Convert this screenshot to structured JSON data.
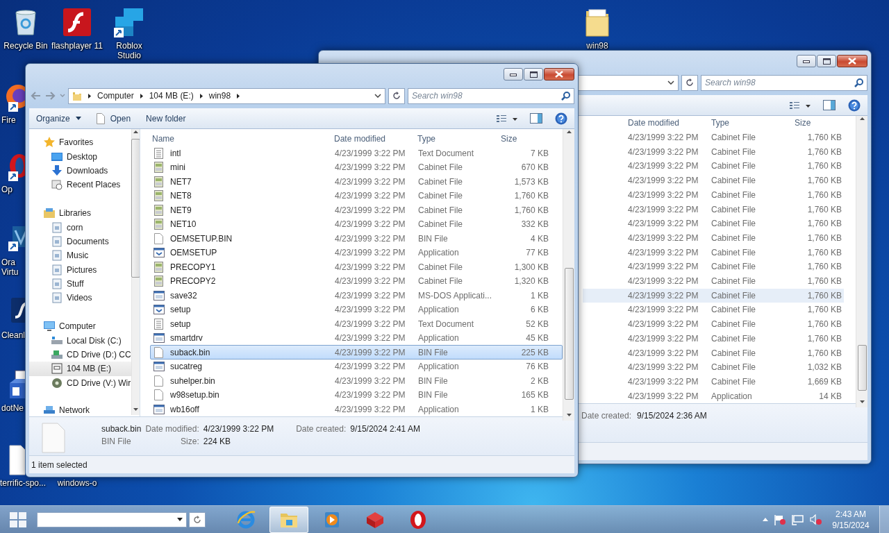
{
  "desktop_icons": [
    {
      "label": "Recycle Bin",
      "kind": "recycle"
    },
    {
      "label": "flashplayer 11",
      "kind": "flash"
    },
    {
      "label": "Roblox Studio",
      "kind": "roblox"
    },
    {
      "label": "win98",
      "kind": "folder"
    },
    {
      "label": "Fire",
      "kind": "firefox"
    },
    {
      "label": "Op",
      "kind": "opera"
    },
    {
      "label": "Ora Virtu",
      "kind": "vbox"
    },
    {
      "label": "Cleanl",
      "kind": "flashdark"
    },
    {
      "label": "dotNe",
      "kind": "setup"
    },
    {
      "label": "terrific-spo...",
      "kind": "blank"
    },
    {
      "label": "windows-o",
      "kind": "none"
    }
  ],
  "back_window": {
    "search_placeholder": "Search win98",
    "columns": [
      "Date modified",
      "Type",
      "Size"
    ],
    "rows": [
      {
        "date": "4/23/1999 3:22 PM",
        "type": "Cabinet File",
        "size": "1,760 KB",
        "selected": false
      },
      {
        "date": "4/23/1999 3:22 PM",
        "type": "Cabinet File",
        "size": "1,760 KB",
        "selected": false
      },
      {
        "date": "4/23/1999 3:22 PM",
        "type": "Cabinet File",
        "size": "1,760 KB",
        "selected": false
      },
      {
        "date": "4/23/1999 3:22 PM",
        "type": "Cabinet File",
        "size": "1,760 KB",
        "selected": false
      },
      {
        "date": "4/23/1999 3:22 PM",
        "type": "Cabinet File",
        "size": "1,760 KB",
        "selected": false
      },
      {
        "date": "4/23/1999 3:22 PM",
        "type": "Cabinet File",
        "size": "1,760 KB",
        "selected": false
      },
      {
        "date": "4/23/1999 3:22 PM",
        "type": "Cabinet File",
        "size": "1,760 KB",
        "selected": false
      },
      {
        "date": "4/23/1999 3:22 PM",
        "type": "Cabinet File",
        "size": "1,760 KB",
        "selected": false
      },
      {
        "date": "4/23/1999 3:22 PM",
        "type": "Cabinet File",
        "size": "1,760 KB",
        "selected": false
      },
      {
        "date": "4/23/1999 3:22 PM",
        "type": "Cabinet File",
        "size": "1,760 KB",
        "selected": false
      },
      {
        "date": "4/23/1999 3:22 PM",
        "type": "Cabinet File",
        "size": "1,760 KB",
        "selected": false
      },
      {
        "date": "4/23/1999 3:22 PM",
        "type": "Cabinet File",
        "size": "1,760 KB",
        "selected": true
      },
      {
        "date": "4/23/1999 3:22 PM",
        "type": "Cabinet File",
        "size": "1,760 KB",
        "selected": false
      },
      {
        "date": "4/23/1999 3:22 PM",
        "type": "Cabinet File",
        "size": "1,760 KB",
        "selected": false
      },
      {
        "date": "4/23/1999 3:22 PM",
        "type": "Cabinet File",
        "size": "1,760 KB",
        "selected": false
      },
      {
        "date": "4/23/1999 3:22 PM",
        "type": "Cabinet File",
        "size": "1,760 KB",
        "selected": false
      },
      {
        "date": "4/23/1999 3:22 PM",
        "type": "Cabinet File",
        "size": "1,032 KB",
        "selected": false
      },
      {
        "date": "4/23/1999 3:22 PM",
        "type": "Cabinet File",
        "size": "1,669 KB",
        "selected": false
      },
      {
        "date": "4/23/1999 3:22 PM",
        "type": "Application",
        "size": "14 KB",
        "selected": false
      }
    ],
    "details": {
      "label": "Date created:",
      "value": "9/15/2024 2:36 AM"
    }
  },
  "window": {
    "breadcrumb": [
      "Computer",
      "104 MB (E:)",
      "win98"
    ],
    "search_placeholder": "Search win98",
    "toolbar": [
      {
        "label": "Organize",
        "kind": "menu"
      },
      {
        "label": "Open",
        "kind": "open"
      },
      {
        "label": "New folder",
        "kind": "plain"
      }
    ],
    "nav": [
      {
        "label": "Favorites",
        "kind": "star",
        "selected": false,
        "children": [
          {
            "label": "Desktop",
            "kind": "desktop",
            "selected": false
          },
          {
            "label": "Downloads",
            "kind": "download",
            "selected": false
          },
          {
            "label": "Recent Places",
            "kind": "recent",
            "selected": false
          }
        ]
      },
      {
        "label": "Libraries",
        "kind": "libraries",
        "selected": false,
        "children": [
          {
            "label": "corn",
            "kind": "library",
            "selected": false
          },
          {
            "label": "Documents",
            "kind": "library",
            "selected": false
          },
          {
            "label": "Music",
            "kind": "library",
            "selected": false
          },
          {
            "label": "Pictures",
            "kind": "library",
            "selected": false
          },
          {
            "label": "Stuff",
            "kind": "library",
            "selected": false
          },
          {
            "label": "Videos",
            "kind": "library",
            "selected": false
          }
        ]
      },
      {
        "label": "Computer",
        "kind": "computer",
        "selected": false,
        "children": [
          {
            "label": "Local Disk (C:)",
            "kind": "disk",
            "selected": false
          },
          {
            "label": "CD Drive (D:) CC",
            "kind": "cd",
            "selected": false
          },
          {
            "label": "104 MB (E:)",
            "kind": "removable",
            "selected": true
          },
          {
            "label": "CD Drive (V:) Wir",
            "kind": "cdv",
            "selected": false
          }
        ]
      },
      {
        "label": "Network",
        "kind": "network",
        "selected": false
      }
    ],
    "columns": [
      "Name",
      "Date modified",
      "Type",
      "Size"
    ],
    "files": [
      {
        "name": "intl",
        "date": "4/23/1999 3:22 PM",
        "type": "Text Document",
        "size": "7 KB",
        "kind": "text",
        "selected": false
      },
      {
        "name": "mini",
        "date": "4/23/1999 3:22 PM",
        "type": "Cabinet File",
        "size": "670 KB",
        "kind": "cabinet",
        "selected": false
      },
      {
        "name": "NET7",
        "date": "4/23/1999 3:22 PM",
        "type": "Cabinet File",
        "size": "1,573 KB",
        "kind": "cabinet",
        "selected": false
      },
      {
        "name": "NET8",
        "date": "4/23/1999 3:22 PM",
        "type": "Cabinet File",
        "size": "1,760 KB",
        "kind": "cabinet",
        "selected": false
      },
      {
        "name": "NET9",
        "date": "4/23/1999 3:22 PM",
        "type": "Cabinet File",
        "size": "1,760 KB",
        "kind": "cabinet",
        "selected": false
      },
      {
        "name": "NET10",
        "date": "4/23/1999 3:22 PM",
        "type": "Cabinet File",
        "size": "332 KB",
        "kind": "cabinet",
        "selected": false
      },
      {
        "name": "OEMSETUP.BIN",
        "date": "4/23/1999 3:22 PM",
        "type": "BIN File",
        "size": "4 KB",
        "kind": "bin",
        "selected": false
      },
      {
        "name": "OEMSETUP",
        "date": "4/23/1999 3:22 PM",
        "type": "Application",
        "size": "77 KB",
        "kind": "app",
        "selected": false
      },
      {
        "name": "PRECOPY1",
        "date": "4/23/1999 3:22 PM",
        "type": "Cabinet File",
        "size": "1,300 KB",
        "kind": "cabinet",
        "selected": false
      },
      {
        "name": "PRECOPY2",
        "date": "4/23/1999 3:22 PM",
        "type": "Cabinet File",
        "size": "1,320 KB",
        "kind": "cabinet",
        "selected": false
      },
      {
        "name": "save32",
        "date": "4/23/1999 3:22 PM",
        "type": "MS-DOS Applicati...",
        "size": "1 KB",
        "kind": "dos",
        "selected": false
      },
      {
        "name": "setup",
        "date": "4/23/1999 3:22 PM",
        "type": "Application",
        "size": "6 KB",
        "kind": "app",
        "selected": false
      },
      {
        "name": "setup",
        "date": "4/23/1999 3:22 PM",
        "type": "Text Document",
        "size": "52 KB",
        "kind": "text",
        "selected": false
      },
      {
        "name": "smartdrv",
        "date": "4/23/1999 3:22 PM",
        "type": "Application",
        "size": "45 KB",
        "kind": "dos",
        "selected": false
      },
      {
        "name": "suback.bin",
        "date": "4/23/1999 3:22 PM",
        "type": "BIN File",
        "size": "225 KB",
        "kind": "bin",
        "selected": true
      },
      {
        "name": "sucatreg",
        "date": "4/23/1999 3:22 PM",
        "type": "Application",
        "size": "76 KB",
        "kind": "dos",
        "selected": false
      },
      {
        "name": "suhelper.bin",
        "date": "4/23/1999 3:22 PM",
        "type": "BIN File",
        "size": "2 KB",
        "kind": "bin",
        "selected": false
      },
      {
        "name": "w98setup.bin",
        "date": "4/23/1999 3:22 PM",
        "type": "BIN File",
        "size": "165 KB",
        "kind": "bin",
        "selected": false
      },
      {
        "name": "wb16off",
        "date": "4/23/1999 3:22 PM",
        "type": "Application",
        "size": "1 KB",
        "kind": "dos",
        "selected": false
      }
    ],
    "details": {
      "name": "suback.bin",
      "type": "BIN File",
      "fields": [
        {
          "label": "Date modified:",
          "value": "4/23/1999 3:22 PM"
        },
        {
          "label": "Date created:",
          "value": "9/15/2024 2:41 AM"
        },
        {
          "label": "Size:",
          "value": "224 KB"
        }
      ]
    },
    "status": "1 item selected"
  },
  "taskbar": {
    "apps": [
      {
        "kind": "ie",
        "active": false
      },
      {
        "kind": "explorer",
        "active": true
      },
      {
        "kind": "media",
        "active": false
      },
      {
        "kind": "cube",
        "active": false
      },
      {
        "kind": "opera",
        "active": false
      }
    ],
    "time": "2:43 AM",
    "date": "9/15/2024"
  }
}
